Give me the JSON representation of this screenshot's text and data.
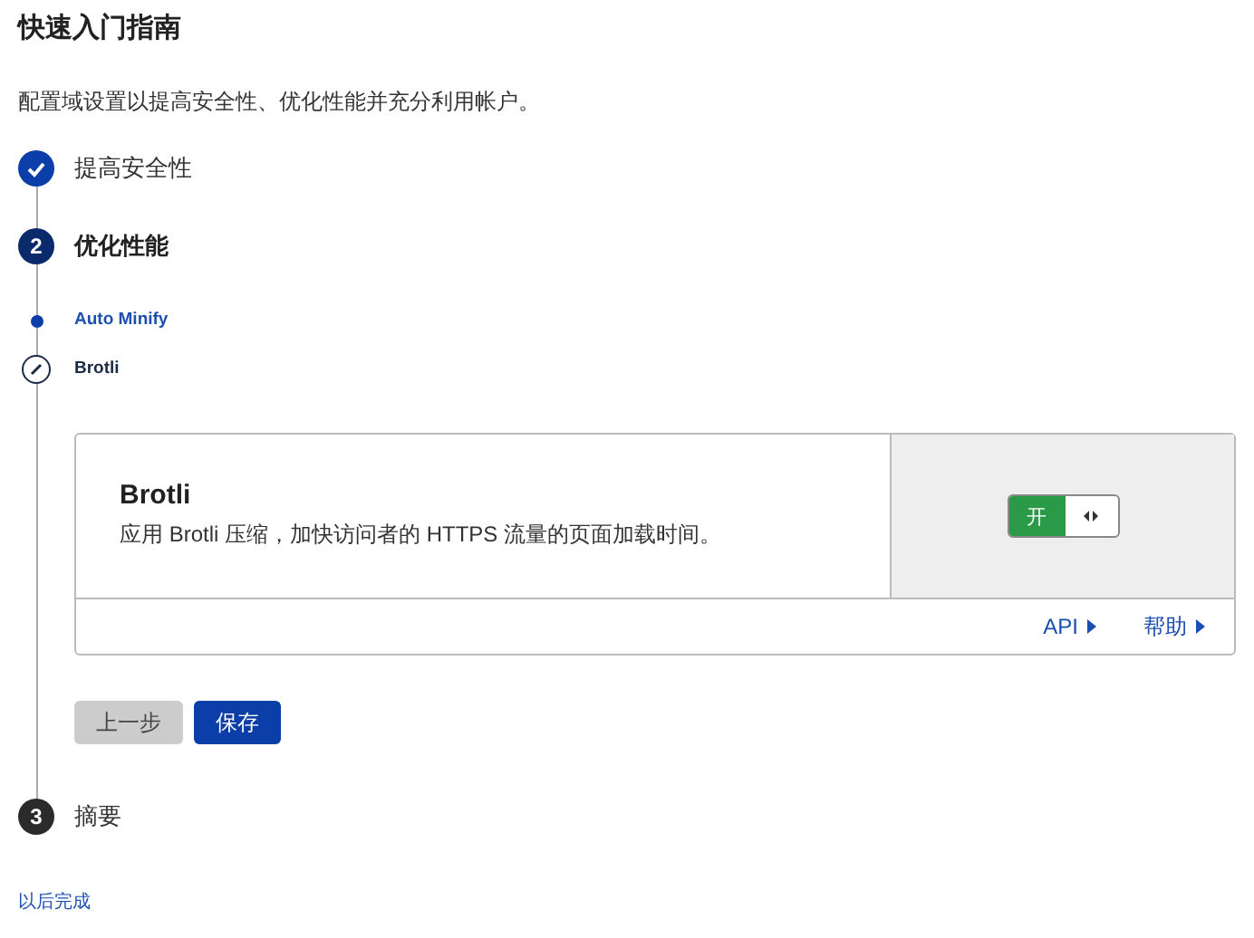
{
  "title": "快速入门指南",
  "subtitle": "配置域设置以提高安全性、优化性能并充分利用帐户。",
  "steps": [
    {
      "kind": "done",
      "label": "提高安全性"
    },
    {
      "kind": "current",
      "number": "2",
      "label": "优化性能",
      "substeps": [
        {
          "kind": "done",
          "label": "Auto Minify"
        },
        {
          "kind": "current",
          "label": "Brotli"
        }
      ],
      "card": {
        "title": "Brotli",
        "description": "应用 Brotli 压缩，加快访问者的 HTTPS 流量的页面加载时间。",
        "toggle": {
          "on_label": "开",
          "on": true
        },
        "links": [
          "API",
          "帮助"
        ]
      },
      "buttons": [
        {
          "kind": "secondary",
          "label": "上一步"
        },
        {
          "kind": "primary",
          "label": "保存"
        }
      ]
    },
    {
      "kind": "upcoming",
      "number": "3",
      "label": "摘要"
    }
  ],
  "footer_link": "以后完成"
}
